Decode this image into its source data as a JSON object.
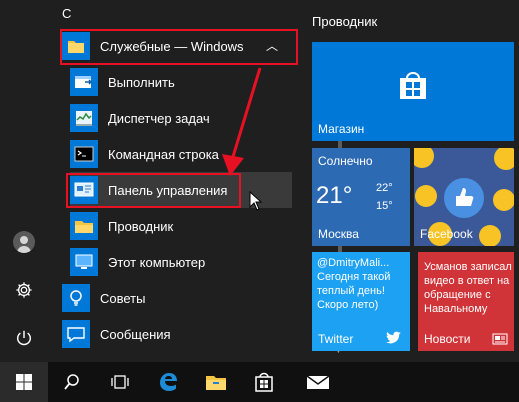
{
  "app_list": {
    "letter": "С",
    "folder": {
      "label": "Служебные — Windows",
      "icon": "folder-icon"
    },
    "items": [
      {
        "label": "Выполнить",
        "icon": "run-icon"
      },
      {
        "label": "Диспетчер задач",
        "icon": "task-manager-icon"
      },
      {
        "label": "Командная строка",
        "icon": "command-prompt-icon"
      },
      {
        "label": "Панель управления",
        "icon": "control-panel-icon"
      },
      {
        "label": "Проводник",
        "icon": "file-explorer-icon"
      },
      {
        "label": "Этот компьютер",
        "icon": "this-pc-icon"
      }
    ],
    "top_items": [
      {
        "label": "Советы",
        "icon": "tips-icon"
      },
      {
        "label": "Сообщения",
        "icon": "messaging-icon"
      }
    ]
  },
  "rail": {
    "user_icon": "user-icon",
    "settings_icon": "gear-icon",
    "power_icon": "power-icon"
  },
  "tiles": {
    "group_title": "Проводник",
    "store": {
      "label": "Магазин",
      "color": "#0078d7"
    },
    "weather": {
      "condition": "Солнечно",
      "temp": "21°",
      "high": "22°",
      "low": "15°",
      "city": "Москва",
      "color": "#2d6ab4"
    },
    "facebook": {
      "label": "Facebook",
      "color": "#3b5998"
    },
    "twitter": {
      "text": "@DmitryMali... Сегодня такой теплый день! Скоро летo)",
      "label": "Twitter",
      "color": "#1da1f2"
    },
    "news": {
      "text": "Усманов записал видео в ответ на обращение с Навальному",
      "label": "Новости",
      "color": "#d13438"
    }
  },
  "taskbar": {
    "start_icon": "windows-start-icon",
    "search_icon": "search-icon",
    "taskview_icon": "task-view-icon",
    "edge_icon": "edge-icon",
    "explorer_icon": "file-explorer-icon",
    "store_icon": "store-icon",
    "mail_icon": "mail-icon"
  },
  "colors": {
    "accent": "#0078d7",
    "annotation": "#e81123",
    "background": "#1f1f1f",
    "taskbar": "#101010"
  }
}
